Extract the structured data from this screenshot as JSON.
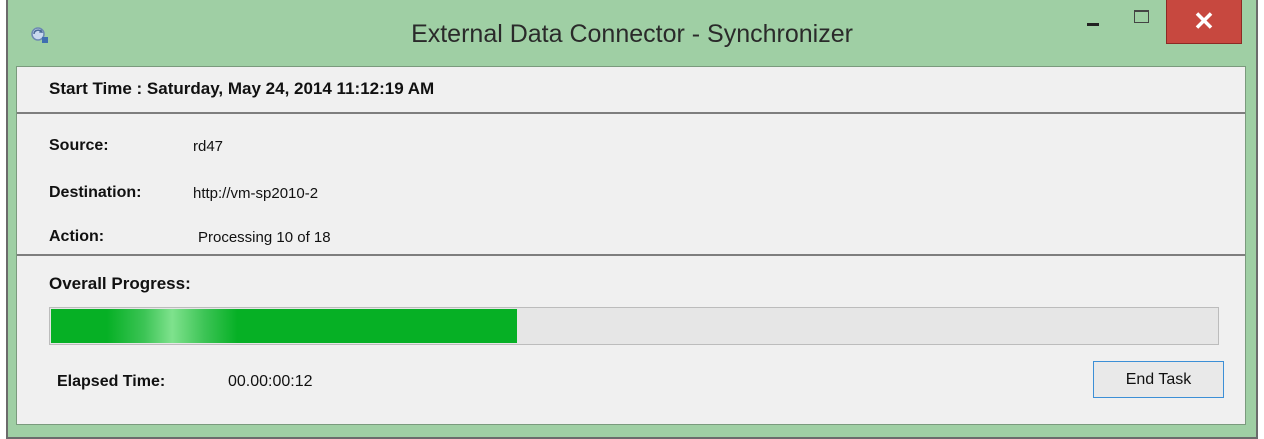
{
  "window": {
    "title": "External Data Connector - Synchronizer",
    "icons": {
      "app": "sync-app-icon",
      "minimize": "minimize-icon",
      "maximize": "maximize-icon",
      "close": "close-icon"
    },
    "close_glyph": "✕"
  },
  "header": {
    "start_time": "Start Time : Saturday, May 24, 2014 11:12:19 AM"
  },
  "info": {
    "source_label": "Source:",
    "source_value": "rd47",
    "destination_label": "Destination:",
    "destination_value": "http://vm-sp2010-2",
    "action_label": "Action:",
    "action_value": "Processing 10 of 18"
  },
  "progress": {
    "label": "Overall Progress:",
    "fraction": 0.4,
    "fill_color": "#06b025"
  },
  "footer": {
    "elapsed_label": "Elapsed Time:",
    "elapsed_value": "00.00:00:12",
    "end_task_label": "End Task"
  },
  "colors": {
    "frame": "#9fcfa4",
    "close_button": "#c7483f",
    "client_background": "#f0f0f0"
  }
}
